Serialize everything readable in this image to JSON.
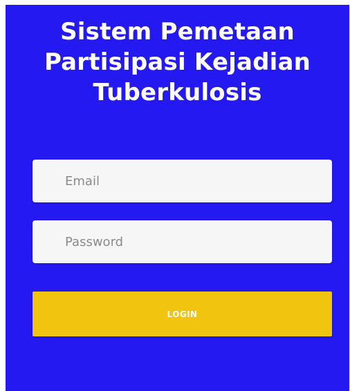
{
  "header": {
    "title_line1": "Sistem Pemetaan",
    "title_line2": "Partisipasi Kejadian",
    "title_line3": "Tuberkulosis"
  },
  "form": {
    "email_placeholder": "Email",
    "email_value": "",
    "password_placeholder": "Password",
    "password_value": "",
    "login_label": "LOGIN"
  },
  "colors": {
    "background": "#2419f0",
    "field_background": "#f6f6f7",
    "button_background": "#f1c40f",
    "title_text": "#ffffff",
    "button_text": "#ffffff"
  }
}
